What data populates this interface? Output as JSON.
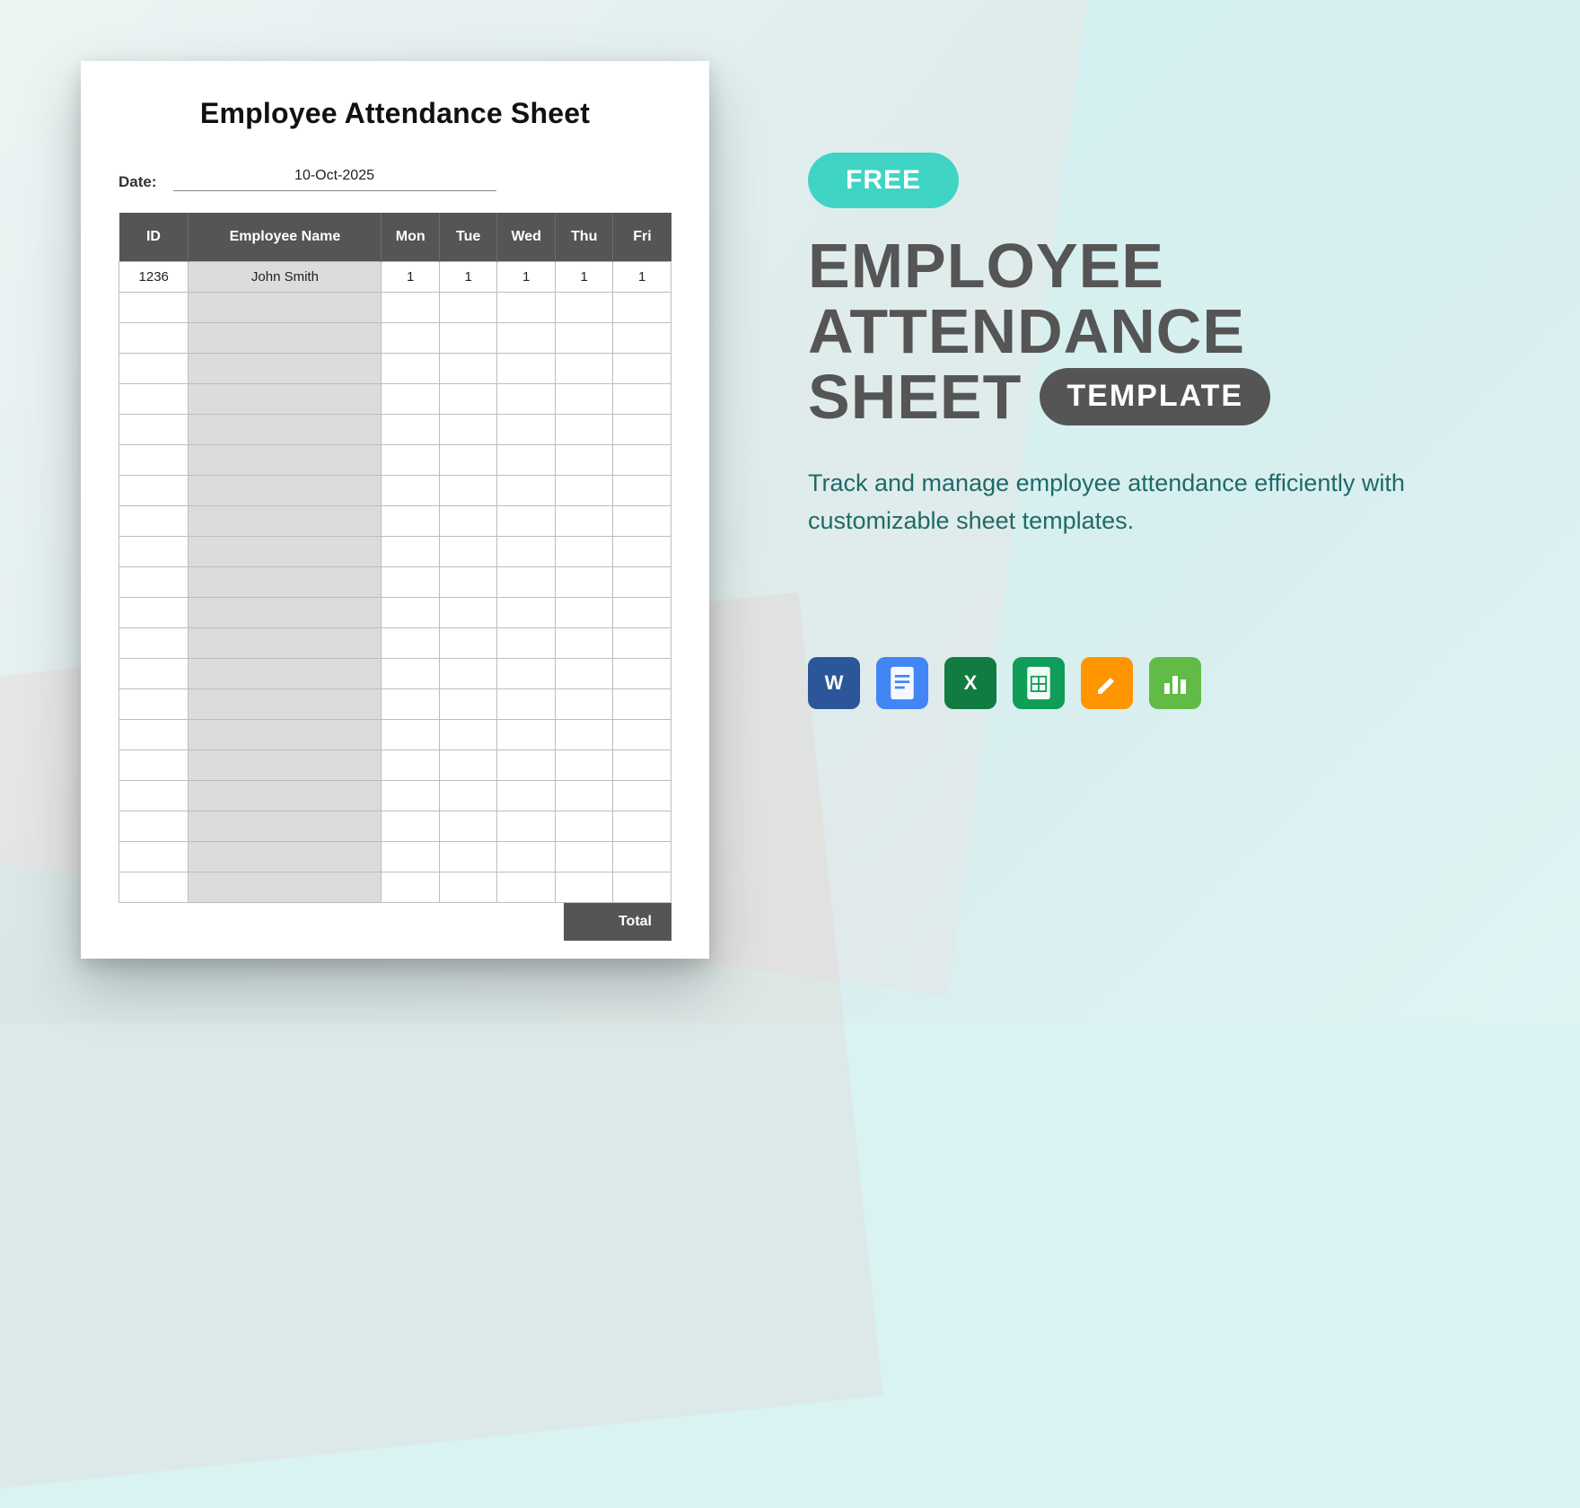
{
  "document": {
    "title": "Employee Attendance Sheet",
    "date_label": "Date:",
    "date_value": "10-Oct-2025",
    "columns": {
      "id": "ID",
      "name": "Employee Name",
      "mon": "Mon",
      "tue": "Tue",
      "wed": "Wed",
      "thu": "Thu",
      "fri": "Fri"
    },
    "rows": [
      {
        "id": "1236",
        "name": "John Smith",
        "mon": "1",
        "tue": "1",
        "wed": "1",
        "thu": "1",
        "fri": "1"
      }
    ],
    "empty_rows": 20,
    "total_label": "Total"
  },
  "promo": {
    "free_badge": "FREE",
    "headline_line1": "EMPLOYEE",
    "headline_line2": "ATTENDANCE",
    "headline_line3": "SHEET",
    "template_pill": "TEMPLATE",
    "tagline": "Track and manage employee attendance efficiently with customizable sheet templates.",
    "apps": [
      {
        "name": "word",
        "label": "W"
      },
      {
        "name": "gdoc",
        "label": ""
      },
      {
        "name": "excel",
        "label": "X"
      },
      {
        "name": "gsheet",
        "label": ""
      },
      {
        "name": "pages",
        "label": ""
      },
      {
        "name": "numbers",
        "label": ""
      }
    ]
  }
}
